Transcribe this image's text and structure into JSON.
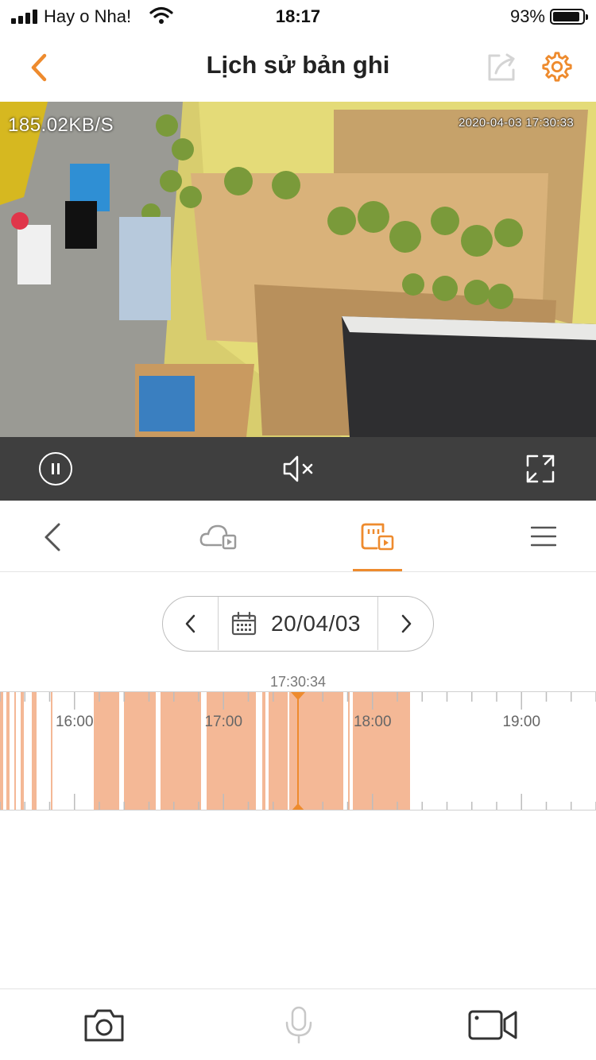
{
  "status_bar": {
    "carrier": "Hay o Nha!",
    "time": "18:17",
    "battery_percent": "93%",
    "battery_level": 0.93
  },
  "header": {
    "title": "Lịch sử bản ghi",
    "back_icon": "chevron-left-icon",
    "share_icon": "share-icon",
    "settings_icon": "gear-icon"
  },
  "video": {
    "speed": "185.02KB/S",
    "timestamp": "2020-04-03 17:30:33"
  },
  "player": {
    "pause_icon": "pause-icon",
    "mute_icon": "speaker-muted-icon",
    "fullscreen_icon": "fullscreen-icon"
  },
  "tabs": [
    {
      "icon": "chevron-left-icon",
      "active": false
    },
    {
      "icon": "cloud-playback-icon",
      "active": false
    },
    {
      "icon": "sd-card-playback-icon",
      "active": true
    },
    {
      "icon": "menu-icon",
      "active": false
    }
  ],
  "date_picker": {
    "date": "20/04/03",
    "prev_icon": "chevron-left-icon",
    "next_icon": "chevron-right-icon",
    "calendar_icon": "calendar-icon"
  },
  "timeline": {
    "current_time": "17:30:34",
    "labels": [
      "16:00",
      "17:00",
      "18:00",
      "19:00"
    ],
    "accent_color": "#ee8b2e",
    "recording_color": "#f4b896"
  },
  "bottom_bar": {
    "snapshot_icon": "camera-icon",
    "talk_icon": "microphone-icon",
    "record_icon": "video-camera-icon"
  },
  "colors": {
    "accent": "#ee8b2e",
    "player_bar": "#3f3f3f"
  }
}
